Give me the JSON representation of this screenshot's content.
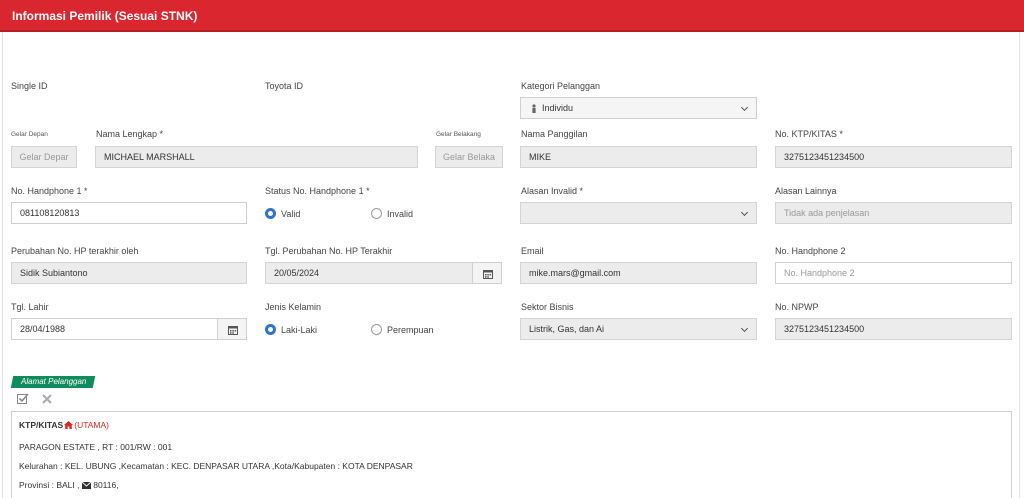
{
  "header": {
    "title": "Informasi Pemilik (Sesuai STNK)"
  },
  "fields": {
    "single_id": {
      "label": "Single ID"
    },
    "toyota_id": {
      "label": "Toyota ID"
    },
    "kategori": {
      "label": "Kategori Pelanggan",
      "value": "Individu"
    },
    "gelar_depan": {
      "label": "Gelar Depan",
      "placeholder": "Gelar Depar"
    },
    "nama_lengkap": {
      "label": "Nama Lengkap *",
      "value": "MICHAEL MARSHALL"
    },
    "gelar_belakang": {
      "label": "Gelar Belakang",
      "placeholder": "Gelar Belaka"
    },
    "nama_panggilan": {
      "label": "Nama Panggilan",
      "value": "MIKE"
    },
    "no_ktp": {
      "label": "No. KTP/KITAS *",
      "value": "3275123451234500"
    },
    "hp1": {
      "label": "No. Handphone 1 *",
      "value": "081108120813"
    },
    "status_hp1": {
      "label": "Status No. Handphone 1 *",
      "options": [
        "Valid",
        "Invalid"
      ],
      "selected": "Valid"
    },
    "alasan_invalid": {
      "label": "Alasan Invalid *",
      "value": ""
    },
    "alasan_lainnya": {
      "label": "Alasan Lainnya",
      "placeholder": "Tidak ada penjelasan"
    },
    "perubahan_hp_oleh": {
      "label": "Perubahan No. HP terakhir oleh",
      "value": "Sidik Subiantono"
    },
    "tgl_perubahan_hp": {
      "label": "Tgl. Perubahan No. HP Terakhir",
      "value": "20/05/2024"
    },
    "email": {
      "label": "Email",
      "value": "mike.mars@gmail.com"
    },
    "hp2": {
      "label": "No. Handphone 2",
      "placeholder": "No. Handphone 2"
    },
    "tgl_lahir": {
      "label": "Tgl. Lahir",
      "value": "28/04/1988"
    },
    "jenis_kelamin": {
      "label": "Jenis Kelamin",
      "options": [
        "Laki-Laki",
        "Perempuan"
      ],
      "selected": "Laki-Laki"
    },
    "sektor_bisnis": {
      "label": "Sektor Bisnis",
      "value": "Listrik, Gas, dan Ai"
    },
    "npwp": {
      "label": "No. NPWP",
      "value": "3275123451234500"
    }
  },
  "alamat": {
    "tag": "Alamat Pelanggan",
    "type": "KTP/KITAS",
    "utama": "(UTAMA)",
    "line1": "PARAGON ESTATE , RT : 001/RW : 001",
    "line2": "Kelurahan : KEL. UBUNG ,Kecamatan : KEC. DENPASAR UTARA ,Kota/Kabupaten : KOTA DENPASAR",
    "line3_prefix": "Provinsi : BALI ,",
    "postal": "80116,"
  },
  "colors": {
    "header": "#d9262f",
    "tag": "#0f8c5e",
    "radio": "#2f74c9",
    "utama": "#e0261f"
  }
}
